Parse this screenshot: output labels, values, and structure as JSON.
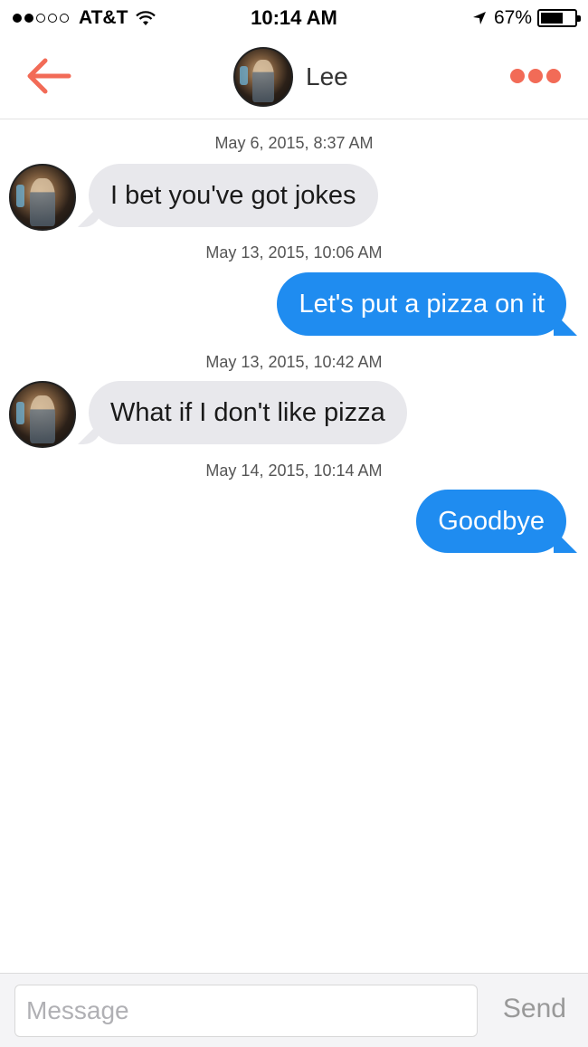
{
  "status_bar": {
    "carrier": "AT&T",
    "time": "10:14 AM",
    "battery_percent": "67%",
    "battery_level": 0.67,
    "signal_bars_filled": 2,
    "signal_bars_total": 5
  },
  "header": {
    "contact_name": "Lee",
    "back_icon": "back-arrow-icon",
    "more_icon": "more-dots-icon",
    "accent_color": "#f26b57"
  },
  "messages": [
    {
      "timestamp": "May 6, 2015, 8:37 AM",
      "direction": "incoming",
      "text": "I bet you've got jokes"
    },
    {
      "timestamp": "May 13, 2015, 10:06 AM",
      "direction": "outgoing",
      "text": "Let's put a pizza on it"
    },
    {
      "timestamp": "May 13, 2015, 10:42 AM",
      "direction": "incoming",
      "text": "What if I don't like pizza"
    },
    {
      "timestamp": "May 14, 2015, 10:14 AM",
      "direction": "outgoing",
      "text": "Goodbye"
    }
  ],
  "composer": {
    "placeholder": "Message",
    "value": "",
    "send_label": "Send"
  },
  "colors": {
    "incoming_bubble": "#e8e8ec",
    "outgoing_bubble": "#1f8cf0"
  }
}
